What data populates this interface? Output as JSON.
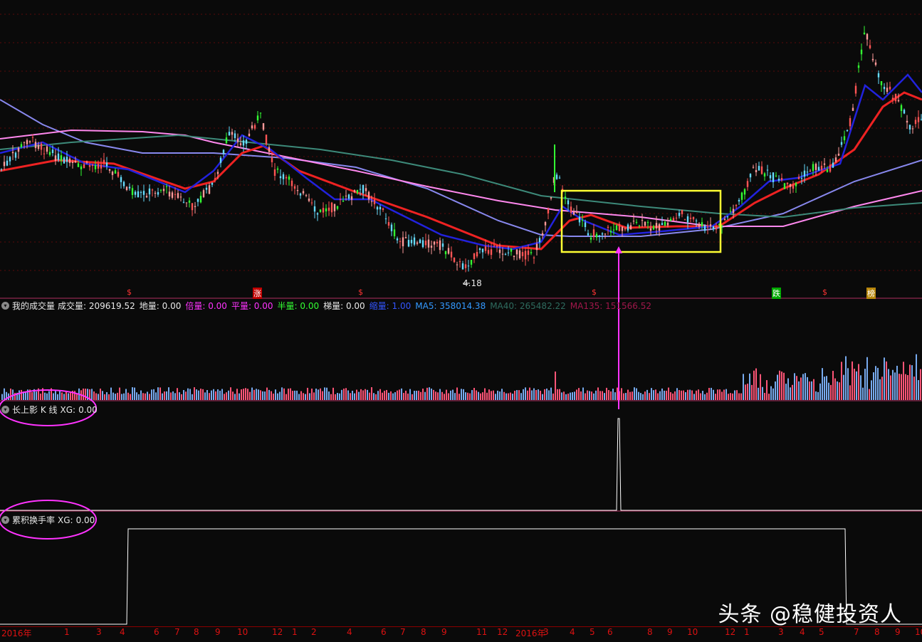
{
  "chart_data": {
    "type": "candlestick-with-indicators",
    "main_panel": {
      "low_annotation": "4.18",
      "signals": [
        {
          "label": "$",
          "color": "#ff3333"
        },
        {
          "label": "涨",
          "color": "#ffffff",
          "bg": "#c00000"
        },
        {
          "label": "$",
          "color": "#ff3333"
        },
        {
          "label": "$",
          "color": "#ff3333"
        },
        {
          "label": "跌",
          "color": "#ffffff",
          "bg": "#00aa00"
        },
        {
          "label": "$",
          "color": "#ff3333"
        },
        {
          "label": "榜",
          "color": "#ffffff",
          "bg": "#b8860b"
        }
      ],
      "highlight_box_color": "#ffff33",
      "arrow_color": "#ff33ff"
    },
    "volume_panel": {
      "title": "我的成交量",
      "items": [
        {
          "label": "成交量:",
          "value": "209619.52",
          "color": "#e8e8e8"
        },
        {
          "label": "地量:",
          "value": "0.00",
          "color": "#e8e8e8"
        },
        {
          "label": "倍量:",
          "value": "0.00",
          "color": "#ff33ff"
        },
        {
          "label": "平量:",
          "value": "0.00",
          "color": "#ff33ff"
        },
        {
          "label": "半量:",
          "value": "0.00",
          "color": "#33ff33"
        },
        {
          "label": "梯量:",
          "value": "0.00",
          "color": "#e8e8e8"
        },
        {
          "label": "缩量:",
          "value": "1.00",
          "color": "#3355ff"
        },
        {
          "label": "MA5:",
          "value": "358014.38",
          "color": "#3399ff"
        },
        {
          "label": "MA40:",
          "value": "265482.22",
          "color": "#2e6b5e"
        },
        {
          "label": "MA135:",
          "value": "151566.52",
          "color": "#a0174a"
        }
      ]
    },
    "indicator1": {
      "title": "长上影 K 线",
      "xg_label": "XG:",
      "xg_value": "0.00"
    },
    "indicator2": {
      "title": "累积换手率",
      "xg_label": "XG:",
      "xg_value": "0.00"
    },
    "x_axis_ticks": [
      "2016年",
      "1",
      "3",
      "4",
      "6",
      "7",
      "8",
      "9",
      "10",
      "12",
      "1",
      "2",
      "4",
      "6",
      "7",
      "8",
      "9",
      "11",
      "12",
      "2016年",
      "3",
      "4",
      "5",
      "6",
      "8",
      "9",
      "10",
      "12",
      "1",
      "3",
      "4",
      "5",
      "7",
      "8",
      "9",
      "10"
    ]
  },
  "watermark": "头条 @稳健投资人"
}
